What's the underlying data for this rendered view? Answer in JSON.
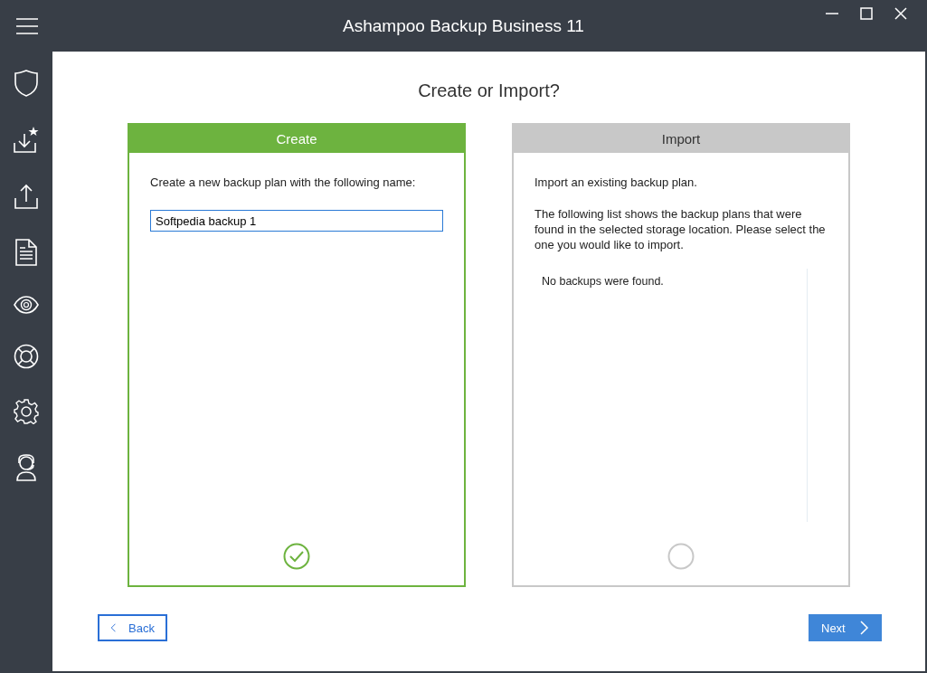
{
  "window": {
    "title": "Ashampoo Backup Business 11"
  },
  "heading": "Create or Import?",
  "options": [
    {
      "title": "Create",
      "selected": true,
      "texts": [
        "Create a new backup plan with the following name:"
      ],
      "name_field": {
        "value": "Softpedia backup 1"
      }
    },
    {
      "title": "Import",
      "selected": false,
      "texts": [
        "Import an existing backup plan.",
        "The following list shows the backup plans that were found in the selected storage location. Please select the one you would like to import."
      ],
      "list_message": "No backups were found."
    }
  ],
  "buttons": [
    {
      "kind": "back",
      "label": "Back"
    },
    {
      "kind": "next",
      "label": "Next"
    }
  ]
}
